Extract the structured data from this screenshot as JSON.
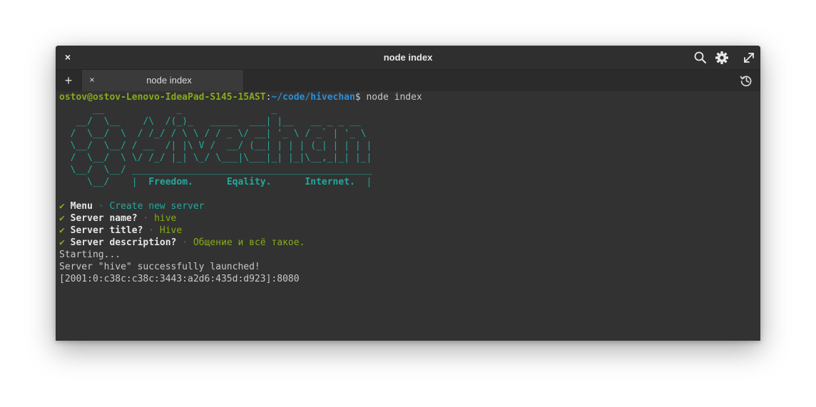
{
  "window": {
    "title": "node index",
    "close_label": "×"
  },
  "tabs": {
    "add_label": "+",
    "items": [
      {
        "label": "node index",
        "close_label": "×"
      }
    ]
  },
  "icons": {
    "search": "search-icon",
    "settings": "gear-icon",
    "maximize": "maximize-icon",
    "history": "history-icon"
  },
  "terminal": {
    "prompt": {
      "user_host": "ostov@ostov-Lenovo-IdeaPad-S145-15AST",
      "separator": ":",
      "path": "~/code/hivechan",
      "symbol": "$",
      "command": " node index"
    },
    "ascii_art": [
      "      __             _                _",
      "   __/  \\__    /\\  /(_)_   _____  ___| |__   __ _ _ __",
      "  /  \\__/  \\  / /_/ / \\ \\ / / _ \\/ __| '_ \\ / _` | '_ \\",
      "  \\__/  \\__/ / __  /| |\\ V /  __/ (__| | | | (_| | | | |",
      "  /  \\__/  \\ \\/ /_/ |_| \\_/ \\___|\\___|_| |_|\\__,_|_| |_|",
      "  \\__/  \\__/ ___________________________________________"
    ],
    "motto": {
      "prefix": "     \\__/    |  ",
      "words": [
        "Freedom.",
        "Eqality.",
        "Internet."
      ],
      "suffix": "  |"
    },
    "answers": [
      {
        "check": "✔",
        "question": "Menu",
        "sep": " · ",
        "answer": "Create new server"
      },
      {
        "check": "✔",
        "question": "Server name?",
        "sep": " · ",
        "answer": "hive"
      },
      {
        "check": "✔",
        "question": "Server title?",
        "sep": " · ",
        "answer": "Hive"
      },
      {
        "check": "✔",
        "question": "Server description?",
        "sep": " · ",
        "answer": "Общение и всё такое."
      }
    ],
    "output": [
      "Starting...",
      "Server \"hive\" successfully launched!",
      "[2001:0:c38c:c38c:3443:a2d6:435d:d923]:8080"
    ]
  }
}
